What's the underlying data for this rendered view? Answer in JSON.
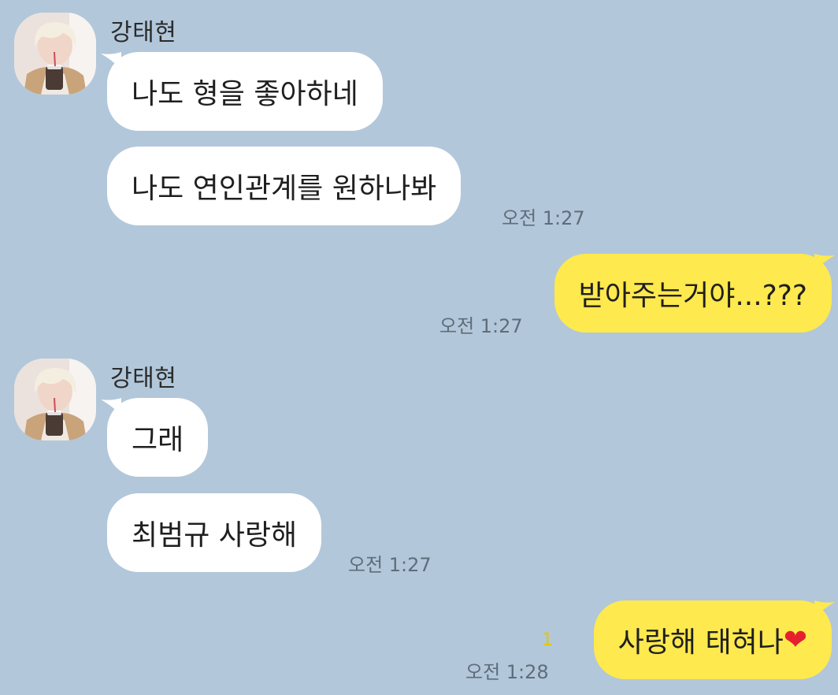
{
  "chat": {
    "groups": [
      {
        "sender": "강태현",
        "avatar_icon": "profile-photo",
        "messages": [
          {
            "text": "나도 형을 좋아하네"
          },
          {
            "text": "나도 연인관계를 원하나봐",
            "time": "오전 1:27"
          }
        ]
      },
      {
        "outgoing": true,
        "messages": [
          {
            "text": "받아주는거야...???",
            "time": "오전 1:27"
          }
        ]
      },
      {
        "sender": "강태현",
        "avatar_icon": "profile-photo",
        "messages": [
          {
            "text": "그래"
          },
          {
            "text": "최범규 사랑해",
            "time": "오전 1:27"
          }
        ]
      },
      {
        "outgoing": true,
        "messages": [
          {
            "text": "사랑해 태혀나",
            "emoji": "❤",
            "unread": "1",
            "time": "오전 1:28"
          }
        ]
      }
    ]
  },
  "colors": {
    "background": "#b2c7da",
    "incoming_bubble": "#ffffff",
    "outgoing_bubble": "#fee94e",
    "unread_count": "#e2c800",
    "timestamp": "#5f6d79"
  }
}
